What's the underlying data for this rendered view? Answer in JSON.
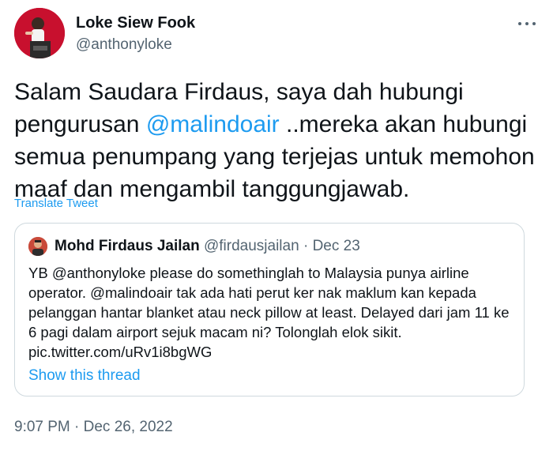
{
  "author": {
    "name": "Loke Siew Fook",
    "handle": "@anthonyloke"
  },
  "more_icon": "more-horizontal-icon",
  "tweet": {
    "text_before": "Salam Saudara Firdaus, saya dah hubungi pengurusan ",
    "mention": "@malindoair",
    "text_after": " ..mereka akan hubungi semua penumpang yang terjejas untuk memohon maaf dan mengambil tanggungjawab.",
    "translate_label": "Translate Tweet",
    "timestamp": "9:07 PM · Dec 26, 2022"
  },
  "quoted_tweet": {
    "name": "Mohd Firdaus Jailan",
    "handle": "@firdausjailan",
    "separator": "·",
    "date": "Dec 23",
    "text": "YB @anthonyloke please do somethinglah to Malaysia punya airline operator. @malindoair tak ada hati perut ker nak maklum kan kepada pelanggan hantar blanket atau neck pillow at least. Delayed dari jam 11 ke 6 pagi dalam airport sejuk macam ni? Tolonglah  elok sikit. pic.twitter.com/uRv1i8bgWG",
    "show_thread_label": "Show this thread"
  },
  "colors": {
    "link": "#1d9bf0",
    "text": "#0f1419",
    "muted": "#536471",
    "border": "#cfd9de"
  }
}
